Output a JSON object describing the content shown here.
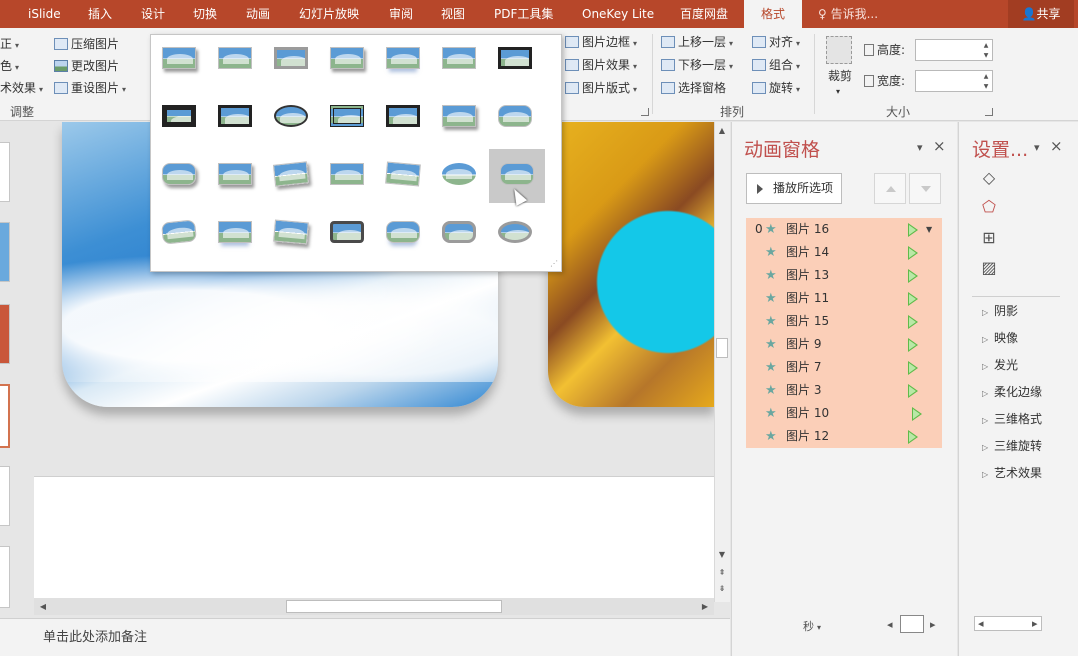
{
  "ribbon_tabs": [
    "iSlide",
    "插入",
    "设计",
    "切换",
    "动画",
    "幻灯片放映",
    "审阅",
    "视图",
    "PDF工具集",
    "OneKey Lite",
    "百度网盘",
    "格式"
  ],
  "active_tab": "格式",
  "tell_me": "告诉我...",
  "share_label": "共享",
  "adjust_group": {
    "label": "调整",
    "partial_left": [
      "正",
      "色",
      "术效果"
    ],
    "compress": "压缩图片",
    "change": "更改图片",
    "reset": "重设图片"
  },
  "style_group": {
    "border": "图片边框",
    "effects": "图片效果",
    "layout": "图片版式"
  },
  "arrange_group": {
    "label": "排列",
    "forward": "上移一层",
    "backward": "下移一层",
    "selection_pane": "选择窗格",
    "align": "对齐",
    "group": "组合",
    "rotate": "旋转"
  },
  "size_group": {
    "label": "大小",
    "crop": "裁剪",
    "height_label": "高度:",
    "width_label": "宽度:",
    "height_value": "",
    "width_value": ""
  },
  "animation_pane": {
    "title": "动画窗格",
    "play_button": "播放所选项",
    "items": [
      {
        "index": "0",
        "name": "图片 16"
      },
      {
        "index": "",
        "name": "图片 14"
      },
      {
        "index": "",
        "name": "图片 13"
      },
      {
        "index": "",
        "name": "图片 11"
      },
      {
        "index": "",
        "name": "图片 15"
      },
      {
        "index": "",
        "name": "图片 9"
      },
      {
        "index": "",
        "name": "图片 7"
      },
      {
        "index": "",
        "name": "图片 3"
      },
      {
        "index": "",
        "name": "图片 10"
      },
      {
        "index": "",
        "name": "图片 12"
      }
    ],
    "seconds_label": "秒"
  },
  "format_pane": {
    "title": "设置...",
    "sections": [
      "阴影",
      "映像",
      "发光",
      "柔化边缘",
      "三维格式",
      "三维旋转",
      "艺术效果"
    ]
  },
  "notes_placeholder": "单击此处添加备注",
  "colors": {
    "ribbon": "#b7472a",
    "accent": "#c0504d",
    "selection": "#fbcfb8"
  }
}
